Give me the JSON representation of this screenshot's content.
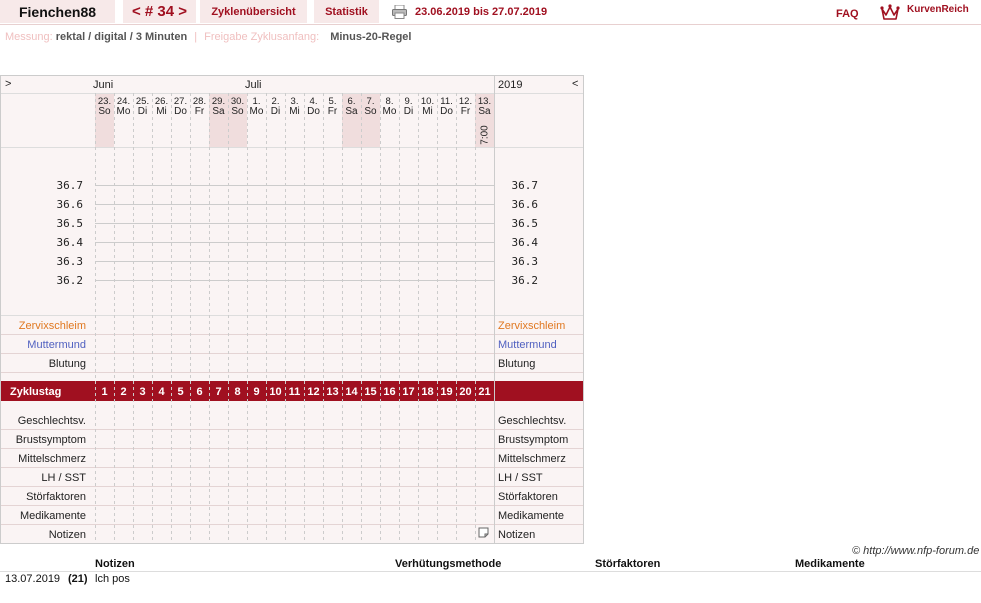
{
  "header": {
    "username": "Fienchen88",
    "cycle_nav": "< # 34 >",
    "overview_tab": "Zyklenübersicht",
    "stats_tab": "Statistik",
    "date_range": "23.06.2019 bis 27.07.2019",
    "faq": "FAQ",
    "logo_text": "KurvenReich"
  },
  "info": {
    "measurement_label": "Messung:",
    "measurement_value": "rektal / digital / 3 Minuten",
    "separator": "|",
    "release_label": "Freigabe Zyklusanfang:",
    "release_value": "Minus-20-Regel"
  },
  "chart": {
    "nav_prev": ">",
    "nav_next": "<",
    "year": "2019",
    "months": [
      {
        "label": "Juni",
        "col": 0
      },
      {
        "label": "Juli",
        "col": 8
      }
    ],
    "days": [
      {
        "num": "23.",
        "wd": "So",
        "weekend": true
      },
      {
        "num": "24.",
        "wd": "Mo",
        "weekend": false
      },
      {
        "num": "25.",
        "wd": "Di",
        "weekend": false
      },
      {
        "num": "26.",
        "wd": "Mi",
        "weekend": false
      },
      {
        "num": "27.",
        "wd": "Do",
        "weekend": false
      },
      {
        "num": "28.",
        "wd": "Fr",
        "weekend": false
      },
      {
        "num": "29.",
        "wd": "Sa",
        "weekend": true
      },
      {
        "num": "30.",
        "wd": "So",
        "weekend": true
      },
      {
        "num": "1.",
        "wd": "Mo",
        "weekend": false
      },
      {
        "num": "2.",
        "wd": "Di",
        "weekend": false
      },
      {
        "num": "3.",
        "wd": "Mi",
        "weekend": false
      },
      {
        "num": "4.",
        "wd": "Do",
        "weekend": false
      },
      {
        "num": "5.",
        "wd": "Fr",
        "weekend": false
      },
      {
        "num": "6.",
        "wd": "Sa",
        "weekend": true
      },
      {
        "num": "7.",
        "wd": "So",
        "weekend": true
      },
      {
        "num": "8.",
        "wd": "Mo",
        "weekend": false
      },
      {
        "num": "9.",
        "wd": "Di",
        "weekend": false
      },
      {
        "num": "10.",
        "wd": "Mi",
        "weekend": false
      },
      {
        "num": "11.",
        "wd": "Do",
        "weekend": false
      },
      {
        "num": "12.",
        "wd": "Fr",
        "weekend": false
      },
      {
        "num": "13.",
        "wd": "Sa",
        "weekend": true
      }
    ],
    "time_label": "7:00",
    "temps": [
      "36.7",
      "36.6",
      "36.5",
      "36.4",
      "36.3",
      "36.2"
    ],
    "row_labels": {
      "cervical": "Zervixschleim",
      "cervix": "Muttermund",
      "bleeding": "Blutung",
      "cycle_day": "Zyklustag",
      "intercourse": "Geschlechtsv.",
      "breast": "Brustsymptom",
      "midpain": "Mittelschmerz",
      "lh": "LH / SST",
      "disturb": "Störfaktoren",
      "meds": "Medikamente",
      "notes": "Notizen"
    },
    "cycle_days": [
      "1",
      "2",
      "3",
      "4",
      "5",
      "6",
      "7",
      "8",
      "9",
      "10",
      "11",
      "12",
      "13",
      "14",
      "15",
      "16",
      "17",
      "18",
      "19",
      "20",
      "21"
    ],
    "note_icon_day": 20,
    "colors": {
      "accent": "#a01020",
      "cervical": "#e07820",
      "cervix": "#5060c0",
      "weekend": "#f0dddd"
    }
  },
  "copyright": "© http://www.nfp-forum.de",
  "notes_table": {
    "headers": {
      "notes": "Notizen",
      "method": "Verhütungsmethode",
      "disturb": "Störfaktoren",
      "meds": "Medikamente"
    },
    "rows": [
      {
        "date": "13.07.2019",
        "day": "(21)",
        "note": "lch pos"
      }
    ]
  }
}
